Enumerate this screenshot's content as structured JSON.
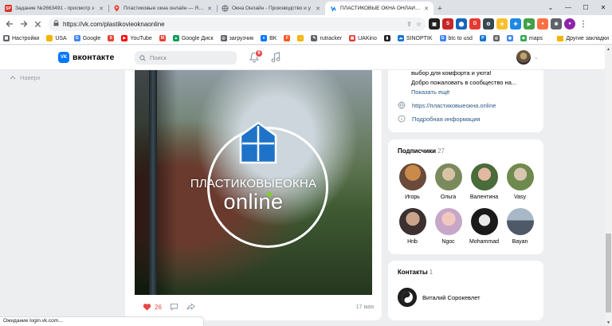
{
  "browser": {
    "tabs": [
      {
        "favicon": "SP",
        "favicon_color": "#d93025",
        "title": "Задание №2663491 - просмотр з"
      },
      {
        "favicon": "",
        "favicon_color": "#ea4335",
        "title": "Пластиковые окна онлайн — Янд"
      },
      {
        "favicon": "",
        "favicon_color": "#9aa0a6",
        "title": "Окна Онлайн - Производство и у"
      },
      {
        "favicon": "",
        "favicon_color": "#0077ff",
        "title": "ПЛАСТИКОВЫЕ ОКНА ОНЛАЙН |"
      }
    ],
    "new_tab_icon": "+",
    "url": "https://vk.com/plastikovieoknaonline",
    "bookmarks": [
      {
        "label": "Настройки",
        "icon_color": "#5f6368"
      },
      {
        "label": "USA",
        "icon_color": "#f4b400"
      },
      {
        "label": "Google",
        "icon_color": "#4285f4"
      },
      {
        "label": "",
        "icon_color": "#ea4335"
      },
      {
        "label": "YouTube",
        "icon_color": "#ff0000"
      },
      {
        "label": "",
        "icon_color": "#ea4335"
      },
      {
        "label": "Google Диск",
        "icon_color": "#0f9d58"
      },
      {
        "label": "загрузчик",
        "icon_color": "#5f6368"
      },
      {
        "label": "BK",
        "icon_color": "#0077ff"
      },
      {
        "label": "",
        "icon_color": "#ff5722"
      },
      {
        "label": "",
        "icon_color": "#f4b400"
      },
      {
        "label": "rutracker",
        "icon_color": "#5f6368"
      },
      {
        "label": "UAKino",
        "icon_color": "#e53935"
      },
      {
        "label": "",
        "icon_color": "#212121"
      },
      {
        "label": "SINOPTIK",
        "icon_color": "#1976d2"
      },
      {
        "label": "btc to usd",
        "icon_color": "#4285f4"
      },
      {
        "label": "",
        "icon_color": "#1976d2"
      },
      {
        "label": "",
        "icon_color": "#5f6368"
      },
      {
        "label": "",
        "icon_color": "#4285f4"
      },
      {
        "label": "maps",
        "icon_color": "#34a853"
      }
    ],
    "other_bookmarks": "Другие закладки",
    "status_text": "Ожидание login.vk.com..."
  },
  "vk": {
    "logo_text": "вконтакте",
    "logo_mark": "VK",
    "search_placeholder": "Поиск",
    "notifications_count": "6",
    "back_label": "Наверх",
    "post": {
      "brand_line1": "ПЛАСТИКОВЫЕОКНА",
      "brand_line2": "online",
      "likes": "26",
      "date": "17 мая"
    },
    "info": {
      "desc_line1": "выбор для комфорта и уюта!",
      "desc_line2": "Добро пожаловать в сообщество на...",
      "show_more": "Показать ещё",
      "site": "https://пластиковыеокна.online",
      "details": "Подробная информация"
    },
    "subscribers": {
      "title": "Подписчики",
      "count": "27",
      "items": [
        {
          "name": "Игорь",
          "c1": "#c98a4a",
          "c2": "#6a4a3a"
        },
        {
          "name": "Ольга",
          "c1": "#d7c2a6",
          "c2": "#7b8a5c"
        },
        {
          "name": "Валентина",
          "c1": "#e3b8a0",
          "c2": "#4a6b3a"
        },
        {
          "name": "Vasy",
          "c1": "#d9c6b2",
          "c2": "#6f8a4e"
        },
        {
          "name": "Hrib",
          "c1": "#caa48a",
          "c2": "#3c3030"
        },
        {
          "name": "Ngoc",
          "c1": "#f0c8c0",
          "c2": "#c7a6c8"
        },
        {
          "name": "Mohammad",
          "c1": "#e8e8e8",
          "c2": "#1a1a1a"
        },
        {
          "name": "Bayan",
          "c1": "#a9b8c6",
          "c2": "#4d5966"
        }
      ]
    },
    "contacts": {
      "title": "Контакты",
      "count": "1",
      "name": "Виталий Сорокевлет"
    }
  }
}
